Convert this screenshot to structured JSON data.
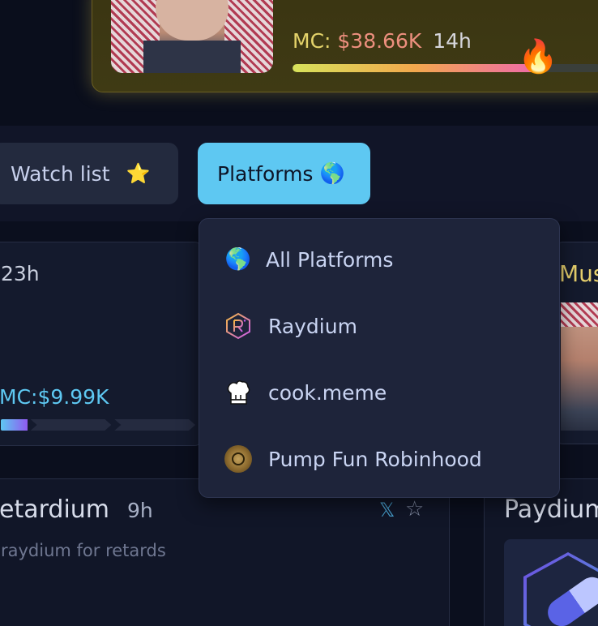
{
  "featured": {
    "mc_label": "MC:",
    "mc_value": "$38.66K",
    "age": "14h",
    "progress": 0.79,
    "fire_icon": "fire-icon"
  },
  "filters": {
    "watchlist_label": "Watch list",
    "watchlist_icon": "⭐",
    "platforms_label": "Platforms",
    "platforms_icon": "🌎"
  },
  "dropdown": {
    "items": [
      {
        "label": "All Platforms",
        "icon": "globe-icon",
        "glyph": "🌎"
      },
      {
        "label": "Raydium",
        "icon": "raydium-icon"
      },
      {
        "label": "cook.meme",
        "icon": "chef-hat-icon"
      },
      {
        "label": "Pump Fun Robinhood",
        "icon": "coin-icon"
      }
    ]
  },
  "cards": {
    "left": {
      "age": "23h",
      "mc": "MC:$9.99K"
    },
    "right": {
      "title": "Mus"
    },
    "bottom_left": {
      "name": "etardium",
      "age": "9h",
      "description": "raydium for retards",
      "x_icon": "𝕏",
      "star_icon": "☆"
    },
    "bottom_right": {
      "name": "Paydium"
    }
  },
  "colors": {
    "accent": "#5ec8f2",
    "background": "#0b0f1e",
    "dropdown_bg": "#1e243a",
    "featured_gold": "#e4d36a"
  }
}
